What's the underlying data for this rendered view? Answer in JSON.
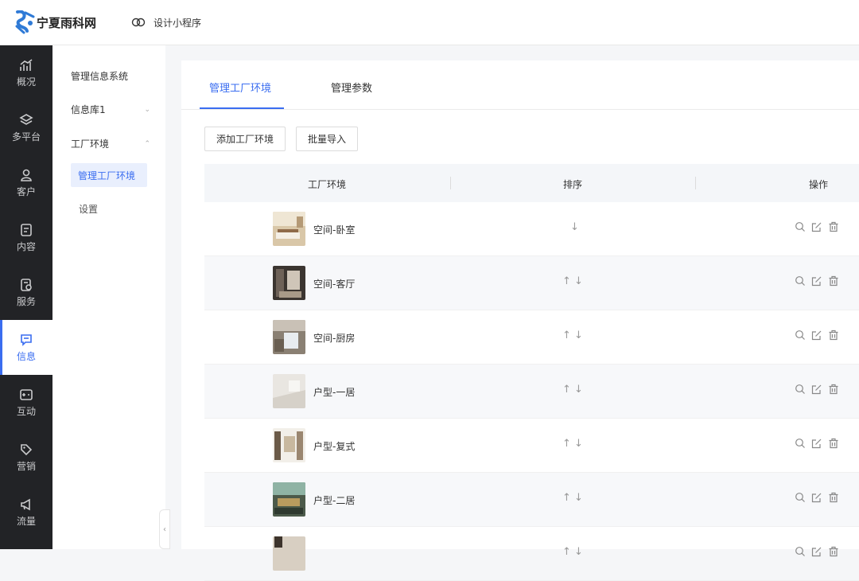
{
  "header": {
    "brand": "宁夏雨科网",
    "mini_program": "设计小程序"
  },
  "nav": [
    {
      "label": "概况",
      "icon": "chart-icon"
    },
    {
      "label": "多平台",
      "icon": "layers-icon"
    },
    {
      "label": "客户",
      "icon": "user-icon"
    },
    {
      "label": "内容",
      "icon": "document-icon"
    },
    {
      "label": "服务",
      "icon": "service-icon"
    },
    {
      "label": "信息",
      "icon": "message-icon"
    },
    {
      "label": "互动",
      "icon": "game-icon"
    },
    {
      "label": "营销",
      "icon": "tag-icon"
    },
    {
      "label": "流量",
      "icon": "megaphone-icon"
    }
  ],
  "subnav": {
    "title": "管理信息系统",
    "library": "信息库1",
    "group": "工厂环境",
    "active_item": "管理工厂环境",
    "settings": "设置"
  },
  "tabs": [
    "管理工厂环境",
    "管理参数"
  ],
  "buttons": {
    "add": "添加工厂环境",
    "import": "批量导入"
  },
  "table": {
    "columns": [
      "工厂环境",
      "排序",
      "操作"
    ],
    "rows": [
      {
        "name": "空间-卧室",
        "sort": "↓"
      },
      {
        "name": "空间-客厅",
        "sort": "↑ ↓"
      },
      {
        "name": "空间-厨房",
        "sort": "↑ ↓"
      },
      {
        "name": "户型-一居",
        "sort": "↑ ↓"
      },
      {
        "name": "户型-复式",
        "sort": "↑ ↓"
      },
      {
        "name": "户型-二居",
        "sort": "↑ ↓"
      },
      {
        "name": "",
        "sort": "↑ ↓"
      }
    ]
  },
  "colors": {
    "accent": "#3a6df0",
    "nav_bg": "#222326"
  }
}
